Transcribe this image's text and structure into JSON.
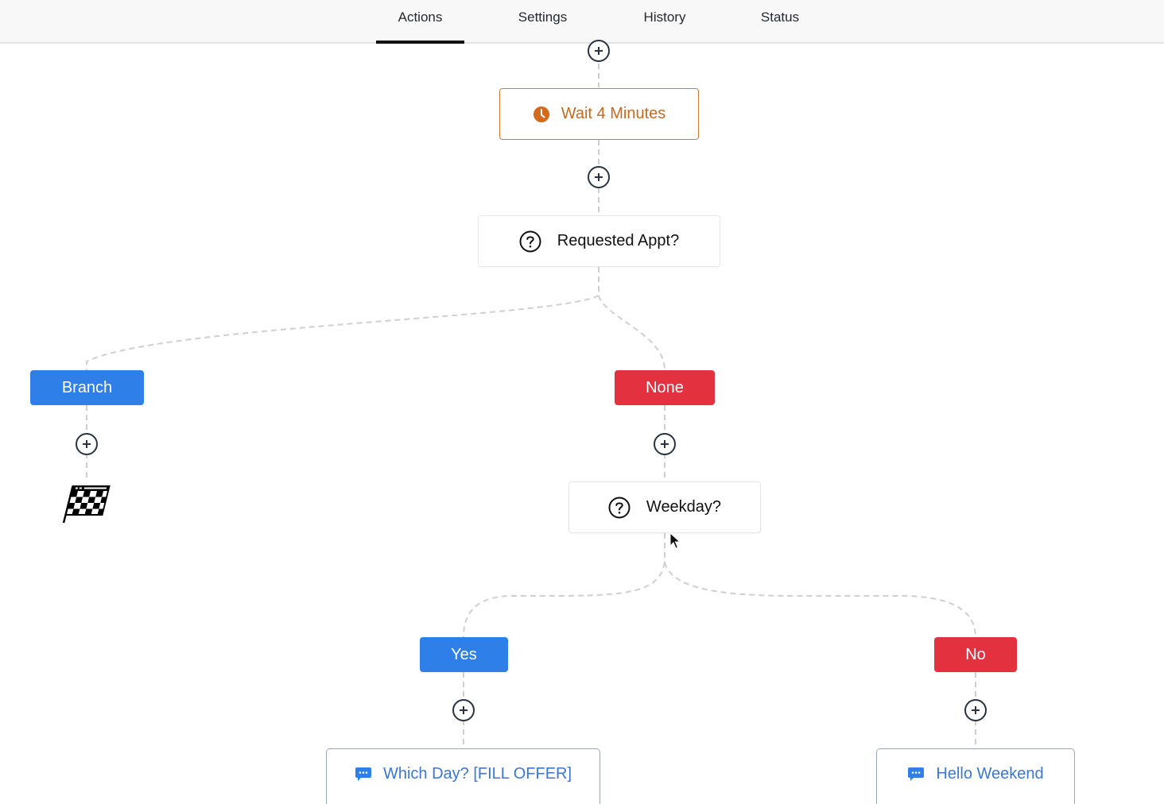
{
  "tabs": [
    {
      "label": "Actions",
      "active": true
    },
    {
      "label": "Settings",
      "active": false
    },
    {
      "label": "History",
      "active": false
    },
    {
      "label": "Status",
      "active": false
    }
  ],
  "workflow": {
    "wait_node": {
      "label": "Wait 4 Minutes",
      "icon": "clock-icon"
    },
    "condition_1": {
      "label": "Requested Appt?",
      "icon": "question-circle-icon"
    },
    "branch_1_left": {
      "label": "Branch"
    },
    "branch_1_right": {
      "label": "None"
    },
    "end_marker": {
      "icon": "checkered-flag-icon"
    },
    "condition_2": {
      "label": "Weekday?",
      "icon": "question-circle-icon"
    },
    "branch_2_left": {
      "label": "Yes"
    },
    "branch_2_right": {
      "label": "No"
    },
    "message_left": {
      "label": "Which Day? [FILL OFFER]",
      "icon": "chat-bubble-icon"
    },
    "message_right": {
      "label": "Hello Weekend",
      "icon": "chat-bubble-icon"
    }
  },
  "colors": {
    "wait": "#d9792f",
    "branch_blue": "#2f7fe8",
    "branch_red": "#e4313f",
    "message_text": "#3a78d4",
    "connector": "#cfcfcf",
    "plus_border": "#2a3340"
  }
}
